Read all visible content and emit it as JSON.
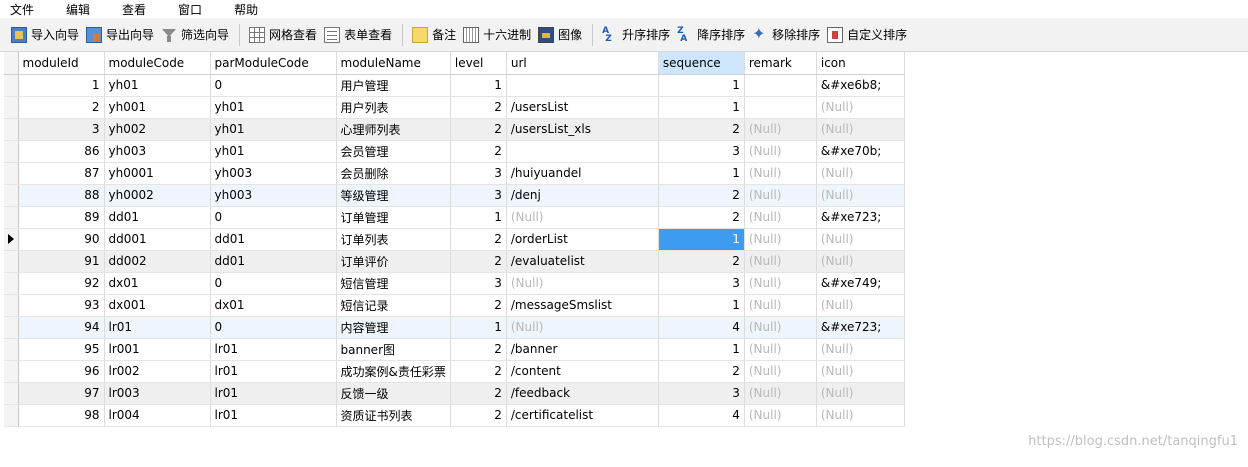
{
  "menu": [
    "文件",
    "编辑",
    "查看",
    "窗口",
    "帮助"
  ],
  "toolbar": {
    "import": "导入向导",
    "export": "导出向导",
    "filter": "筛选向导",
    "grid_view": "网格查看",
    "form_view": "表单查看",
    "note": "备注",
    "hex": "十六进制",
    "image": "图像",
    "sort_asc": "升序排序",
    "sort_desc": "降序排序",
    "remove_sort": "移除排序",
    "custom_sort": "自定义排序"
  },
  "table": {
    "columns": [
      "moduleId",
      "moduleCode",
      "parModuleCode",
      "moduleName",
      "level",
      "url",
      "sequence",
      "remark",
      "icon"
    ],
    "selected_column": "sequence",
    "rows": [
      [
        "1",
        "yh01",
        "0",
        "用户管理",
        "1",
        "",
        "1",
        "",
        "&#xe6b8;"
      ],
      [
        "2",
        "yh001",
        "yh01",
        "用户列表",
        "2",
        "/usersList",
        "1",
        "",
        "(Null)"
      ],
      [
        "3",
        "yh002",
        "yh01",
        "心理师列表",
        "2",
        "/usersList_xls",
        "2",
        "(Null)",
        "(Null)"
      ],
      [
        "86",
        "yh003",
        "yh01",
        "会员管理",
        "2",
        "",
        "3",
        "(Null)",
        "&#xe70b;"
      ],
      [
        "87",
        "yh0001",
        "yh003",
        "会员删除",
        "3",
        "/huiyuandel",
        "1",
        "(Null)",
        "(Null)"
      ],
      [
        "88",
        "yh0002",
        "yh003",
        "等级管理",
        "3",
        "/denj",
        "2",
        "(Null)",
        "(Null)"
      ],
      [
        "89",
        "dd01",
        "0",
        "订单管理",
        "1",
        "(Null)",
        "2",
        "(Null)",
        "&#xe723;"
      ],
      [
        "90",
        "dd001",
        "dd01",
        "订单列表",
        "2",
        "/orderList",
        "1",
        "(Null)",
        "(Null)"
      ],
      [
        "91",
        "dd002",
        "dd01",
        "订单评价",
        "2",
        "/evaluatelist",
        "2",
        "(Null)",
        "(Null)"
      ],
      [
        "92",
        "dx01",
        "0",
        "短信管理",
        "3",
        "(Null)",
        "3",
        "(Null)",
        "&#xe749;"
      ],
      [
        "93",
        "dx001",
        "dx01",
        "短信记录",
        "2",
        "/messageSmslist",
        "1",
        "(Null)",
        "(Null)"
      ],
      [
        "94",
        "lr01",
        "0",
        "内容管理",
        "1",
        "(Null)",
        "4",
        "(Null)",
        "&#xe723;"
      ],
      [
        "95",
        "lr001",
        "lr01",
        "banner图",
        "2",
        "/banner",
        "1",
        "(Null)",
        "(Null)"
      ],
      [
        "96",
        "lr002",
        "lr01",
        "成功案例&责任彩票",
        "2",
        "/content",
        "2",
        "(Null)",
        "(Null)"
      ],
      [
        "97",
        "lr003",
        "lr01",
        "反馈一级",
        "2",
        "/feedback",
        "3",
        "(Null)",
        "(Null)"
      ],
      [
        "98",
        "lr004",
        "lr01",
        "资质证书列表",
        "2",
        "/certificatelist",
        "4",
        "(Null)",
        "(Null)"
      ]
    ],
    "current_row_index": 7,
    "current_col_index": 6
  },
  "watermark": "https://blog.csdn.net/tanqingfu1"
}
